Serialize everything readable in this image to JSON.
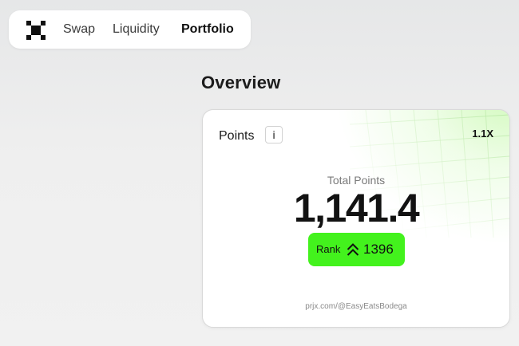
{
  "nav": {
    "logo_icon": "prjx-logo-icon",
    "items": [
      {
        "label": "Swap",
        "active": false
      },
      {
        "label": "Liquidity",
        "active": false
      },
      {
        "label": "Portfolio",
        "active": true
      }
    ]
  },
  "page": {
    "title": "Overview"
  },
  "points_card": {
    "label": "Points",
    "info_button_label": "i",
    "multiplier": "1.1X",
    "total_label": "Total Points",
    "total_value": "1,141.4",
    "rank": {
      "label": "Rank",
      "icon": "rank-chevrons-icon",
      "value": "1396"
    },
    "share_url": "prjx.com/@EasyEatsBodega"
  },
  "colors": {
    "accent_green": "#43f21d",
    "background": "#efefef",
    "card_background": "#ffffff"
  }
}
